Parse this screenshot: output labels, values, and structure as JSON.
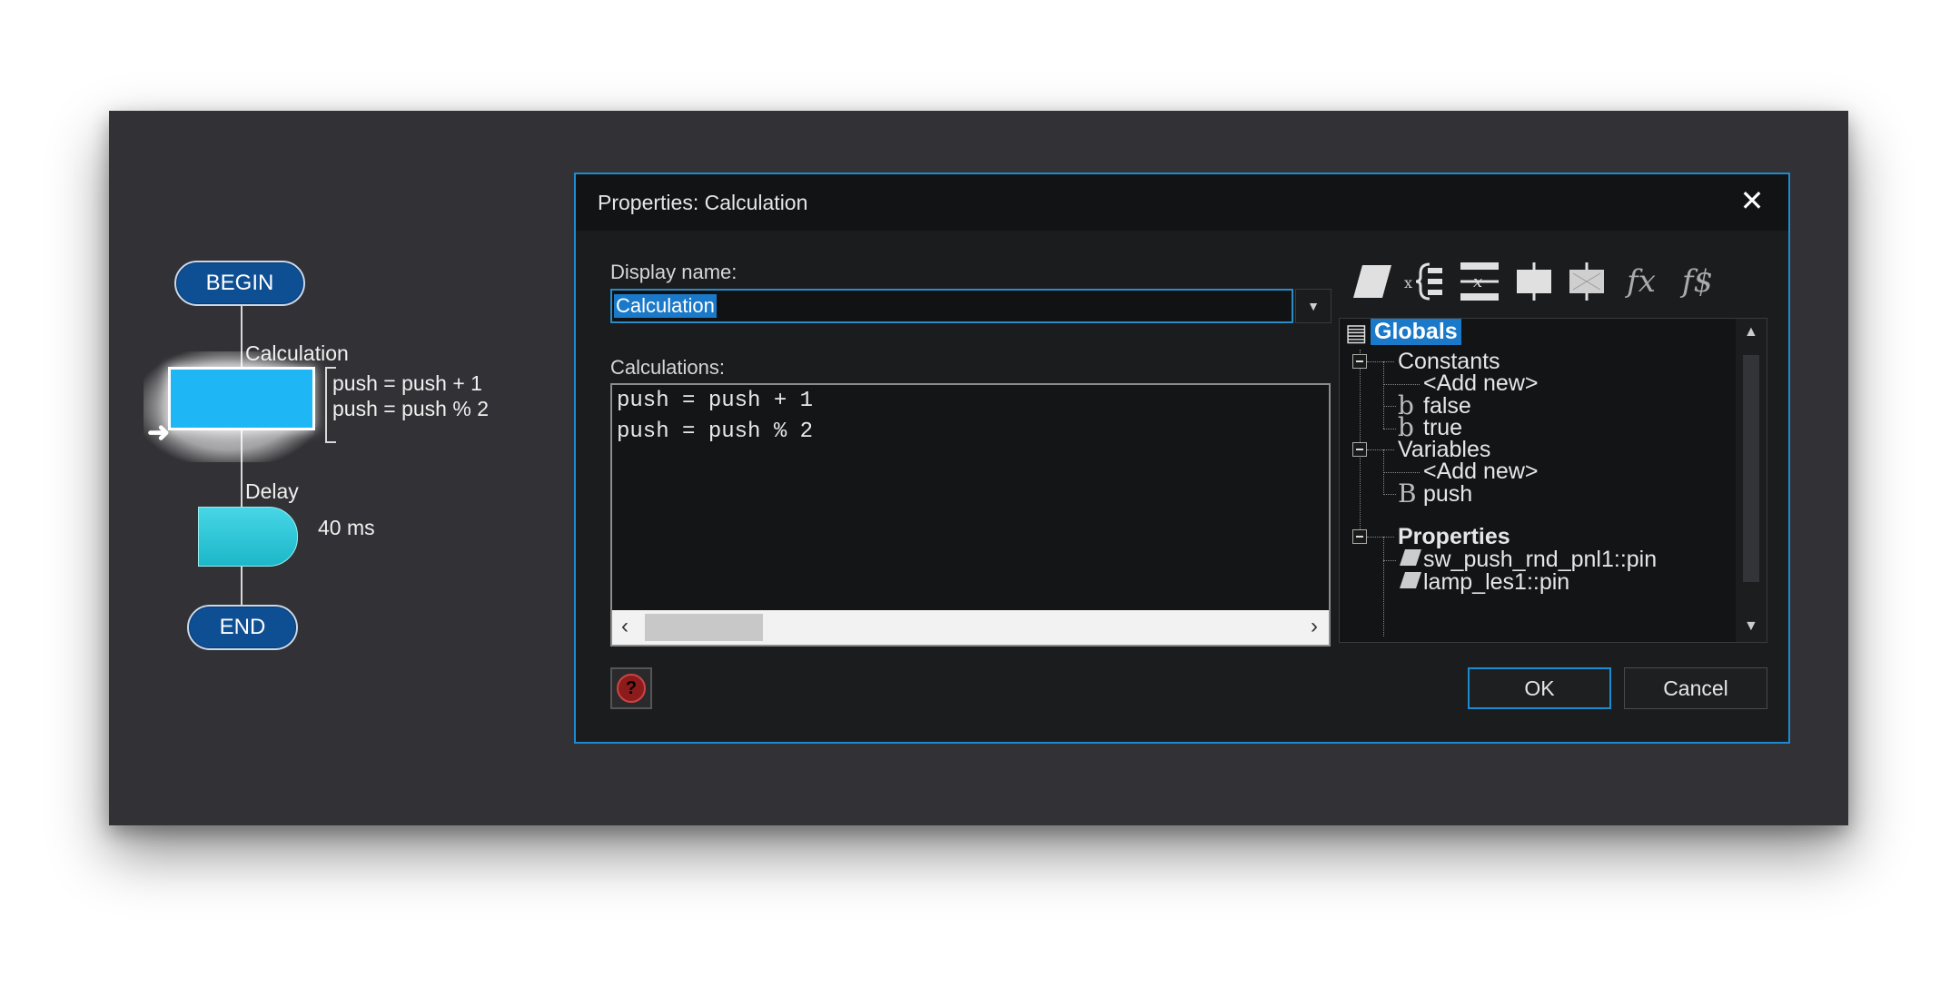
{
  "flowchart": {
    "begin_label": "BEGIN",
    "end_label": "END",
    "calculation_title": "Calculation",
    "calculation_lines": [
      "push = push + 1",
      "push = push % 2"
    ],
    "delay_title": "Delay",
    "delay_value": "40 ms"
  },
  "dialog": {
    "title": "Properties: Calculation",
    "close_label": "✕",
    "display_name_label": "Display name:",
    "display_name_value": "Calculation",
    "calculations_label": "Calculations:",
    "code_lines": [
      "push = push + 1",
      "push = push % 2"
    ],
    "help_label": "?",
    "ok_label": "OK",
    "cancel_label": "Cancel"
  },
  "tree": {
    "root": "Globals",
    "constants": "Constants",
    "constants_add": "<Add new>",
    "const_false": "false",
    "const_true": "true",
    "variables": "Variables",
    "variables_add": "<Add new>",
    "var_push": "push",
    "properties": "Properties",
    "prop_1": "sw_push_rnd_pnl1::pin",
    "prop_2": "lamp_les1::pin"
  },
  "toolbar_icons": [
    "parallelogram-icon",
    "variable-icon",
    "expression-icon",
    "io-port-icon",
    "io-block-icon",
    "function-icon",
    "string-function-icon"
  ],
  "colors": {
    "accent": "#1d8bd1",
    "calc_box": "#1fb6f5",
    "terminator": "#0e4f94",
    "delay": "#2cc6d8"
  }
}
